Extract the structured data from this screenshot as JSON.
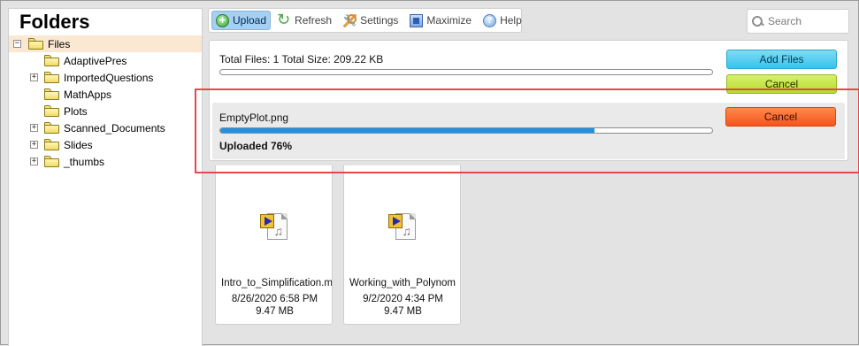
{
  "sidebar": {
    "title": "Folders",
    "root": {
      "label": "Files",
      "toggle": "−"
    },
    "items": [
      {
        "label": "AdaptivePres",
        "expandable": false
      },
      {
        "label": "ImportedQuestions",
        "expandable": true
      },
      {
        "label": "MathApps",
        "expandable": false
      },
      {
        "label": "Plots",
        "expandable": false
      },
      {
        "label": "Scanned_Documents",
        "expandable": true
      },
      {
        "label": "Slides",
        "expandable": true
      },
      {
        "label": "_thumbs",
        "expandable": true
      }
    ]
  },
  "toolbar": {
    "upload": "Upload",
    "refresh": "Refresh",
    "settings": "Settings",
    "maximize": "Maximize",
    "help": "Help"
  },
  "search": {
    "placeholder": "Search"
  },
  "upload_panel": {
    "total_text": "Total Files: 1 Total Size: 209.22 KB",
    "total_progress": 0,
    "add_files_label": "Add Files",
    "cancel_all_label": "Cancel",
    "file": {
      "name": "EmptyPlot.png",
      "progress": 0.76,
      "status": "Uploaded 76%",
      "cancel_label": "Cancel"
    }
  },
  "tiles": [
    {
      "name": "Intro_to_Simplification.m",
      "date": "8/26/2020 6:58 PM",
      "size": "9.47 MB"
    },
    {
      "name": "Working_with_Polynom",
      "date": "9/2/2020 4:34 PM",
      "size": "9.47 MB"
    }
  ],
  "colors": {
    "accent_blue": "#1e90e6",
    "add_files": "#35c4ec",
    "cancel_green": "#b5db2c",
    "cancel_orange": "#f5541d",
    "highlight_red": "#e6484a"
  }
}
